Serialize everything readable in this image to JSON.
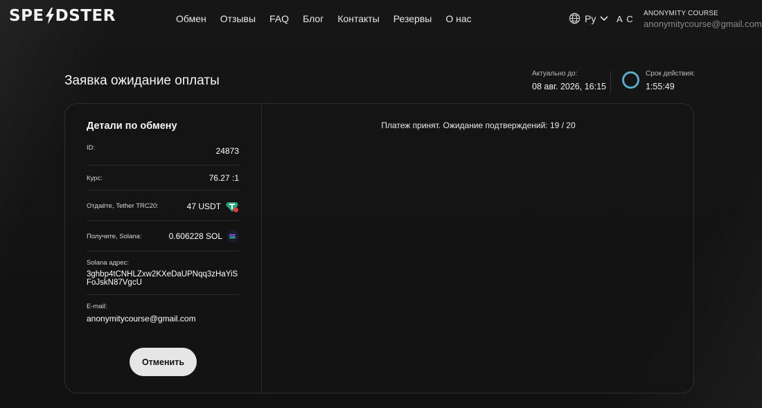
{
  "header": {
    "logo_text_left": "SPE",
    "logo_text_right": "DSTER",
    "nav": [
      "Обмен",
      "Отзывы",
      "FAQ",
      "Блог",
      "Контакты",
      "Резервы",
      "О нас"
    ],
    "lang": "Ру",
    "initials": "А С",
    "user_name": "ANONYMITY COURSE",
    "user_email": "anonymitycourse@gmail.com"
  },
  "page": {
    "title": "Заявка ожидание оплаты",
    "actual_label": "Актуально до:",
    "actual_value": "08 авг. 2026, 16:15",
    "term_label": "Срок действия:",
    "term_value": "1:55:49"
  },
  "details": {
    "title": "Детали по обмену",
    "id_label": "ID:",
    "id_value": "24873",
    "rate_label": "Курс:",
    "rate_value": "76.27 :1",
    "give_label": "Отдаёте, Tether TRC20:",
    "give_value": "47 USDT",
    "get_label": "Получите, Solana:",
    "get_value": "0.606228 SOL",
    "address_label": "Solana адрес:",
    "address_value": "3ghbp4tCNHLZxw2KXeDaUPNqq3zHaYiSFoJskN87VgcU",
    "email_label": "E-mail:",
    "email_value": "anonymitycourse@gmail.com",
    "cancel_label": "Отменить"
  },
  "status": {
    "text": "Платеж принят. Ожидание подтверждений: 19 / 20"
  },
  "colors": {
    "tether": "#26a17b",
    "ring": "#5aa9c8"
  }
}
